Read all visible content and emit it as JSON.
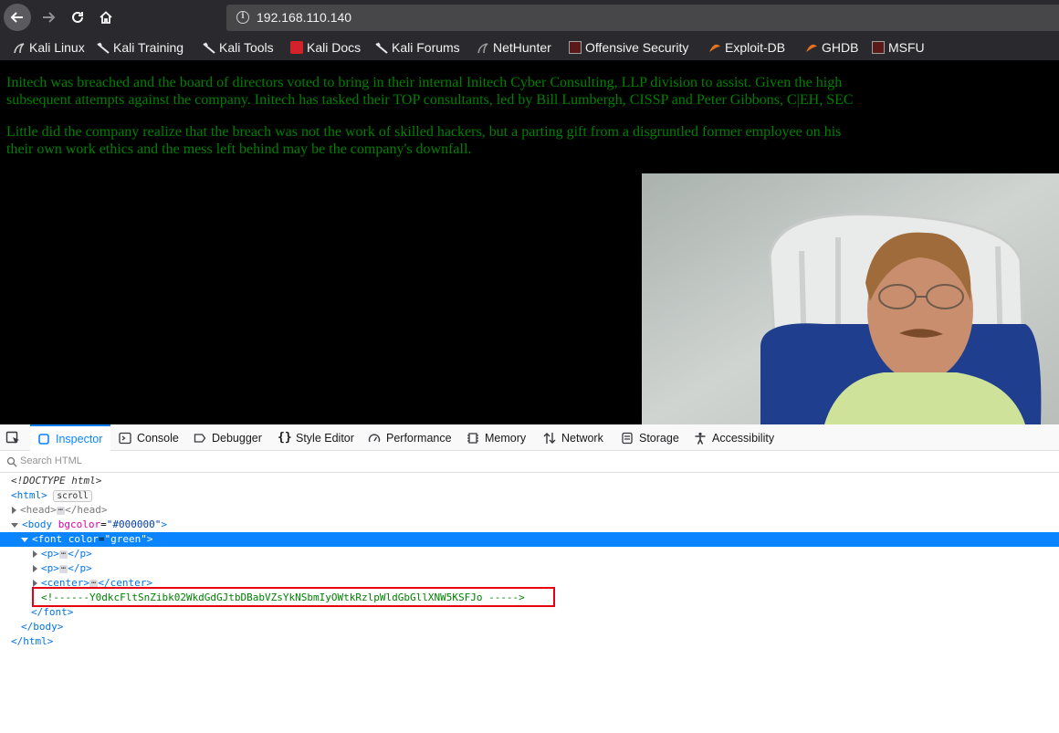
{
  "browser": {
    "url": "192.168.110.140",
    "bookmarks": [
      {
        "label": "Kali Linux",
        "icon": "kali-dragon-icon"
      },
      {
        "label": "Kali Training",
        "icon": "kali-dragon-icon"
      },
      {
        "label": "Kali Tools",
        "icon": "kali-dragon-icon"
      },
      {
        "label": "Kali Docs",
        "icon": "kali-docs-icon"
      },
      {
        "label": "Kali Forums",
        "icon": "kali-dragon-icon"
      },
      {
        "label": "NetHunter",
        "icon": "nethunter-icon"
      },
      {
        "label": "Offensive Security",
        "icon": "offsec-icon"
      },
      {
        "label": "Exploit-DB",
        "icon": "exploitdb-icon"
      },
      {
        "label": "GHDB",
        "icon": "exploitdb-icon"
      },
      {
        "label": "MSFU",
        "icon": "offsec-icon"
      }
    ]
  },
  "page": {
    "background": "#000000",
    "text_color": "#008000",
    "paragraph1_line1": "Initech was breached and the board of directors voted to bring in their internal Initech Cyber Consulting, LLP division to assist. Given the high",
    "paragraph1_line2": "subsequent attempts against the company. Initech has tasked their TOP consultants, led by Bill Lumbergh, CISSP and Peter Gibbons, C|EH, SEC",
    "paragraph2_line1": "Little did the company realize that the breach was not the work of skilled hackers, but a parting gift from a disgruntled former employee on his",
    "paragraph2_line2": "their own work ethics and the mess left behind may be the company's downfall."
  },
  "devtools": {
    "tabs": [
      {
        "label": "Inspector",
        "icon": "inspector-icon",
        "active": true
      },
      {
        "label": "Console",
        "icon": "console-icon"
      },
      {
        "label": "Debugger",
        "icon": "debugger-icon"
      },
      {
        "label": "Style Editor",
        "icon": "braces-icon"
      },
      {
        "label": "Performance",
        "icon": "gauge-icon"
      },
      {
        "label": "Memory",
        "icon": "chip-icon"
      },
      {
        "label": "Network",
        "icon": "arrows-updown-icon"
      },
      {
        "label": "Storage",
        "icon": "storage-icon"
      },
      {
        "label": "Accessibility",
        "icon": "accessibility-icon"
      }
    ],
    "search_placeholder": "Search HTML",
    "tree": {
      "doctype": "<!DOCTYPE html>",
      "html_open": "<html>",
      "scroll_badge": "scroll",
      "head_open": "<head>",
      "head_close": "</head>",
      "body_tag": "body",
      "body_attr": "bgcolor",
      "body_val": "\"#000000\"",
      "font_tag": "font",
      "font_attr": "color",
      "font_val": "\"green\"",
      "p_open": "<p>",
      "p_close": "</p>",
      "center_open": "<center>",
      "center_close": "</center>",
      "comment": "<!------Y0dkcFltSnZibk02WkdGdGJtbDBabVZsYkNSbmIyOWtkRzlpWldGbGllXNW5KSFJo ----->",
      "font_close": "</font>",
      "body_close": "</body>",
      "html_close": "</html>",
      "ellipsis": "⋯"
    }
  }
}
